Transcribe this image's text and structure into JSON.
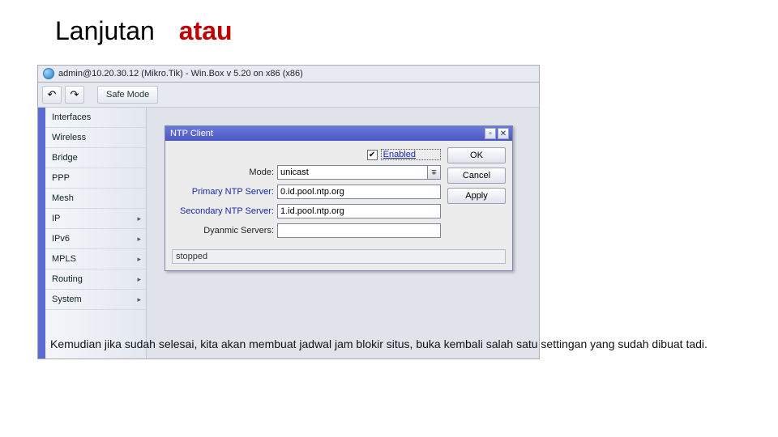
{
  "header": {
    "title": "Lanjutan",
    "or": "atau"
  },
  "window": {
    "title": "admin@10.20.30.12 (Mikro.Tik) - Win.Box v 5.20 on x86 (x86)"
  },
  "toolbar": {
    "safe_mode": "Safe Mode"
  },
  "sidebar": {
    "items": [
      {
        "label": "Interfaces",
        "sub": false
      },
      {
        "label": "Wireless",
        "sub": false
      },
      {
        "label": "Bridge",
        "sub": false
      },
      {
        "label": "PPP",
        "sub": false
      },
      {
        "label": "Mesh",
        "sub": false
      },
      {
        "label": "IP",
        "sub": true
      },
      {
        "label": "IPv6",
        "sub": true
      },
      {
        "label": "MPLS",
        "sub": true
      },
      {
        "label": "Routing",
        "sub": true
      },
      {
        "label": "System",
        "sub": true
      }
    ]
  },
  "dialog": {
    "title": "NTP Client",
    "enabled_label": "Enabled",
    "enabled_checked": true,
    "mode_label": "Mode:",
    "mode_value": "unicast",
    "primary_label": "Primary NTP Server:",
    "primary_value": "0.id.pool.ntp.org",
    "secondary_label": "Secondary NTP Server:",
    "secondary_value": "1.id.pool.ntp.org",
    "dynamic_label": "Dyanmic Servers:",
    "dynamic_value": "",
    "status": "stopped",
    "buttons": {
      "ok": "OK",
      "cancel": "Cancel",
      "apply": "Apply"
    }
  },
  "footer": "Kemudian jika sudah selesai, kita akan membuat jadwal jam blokir situs, buka kembali salah satu settingan yang sudah dibuat tadi."
}
